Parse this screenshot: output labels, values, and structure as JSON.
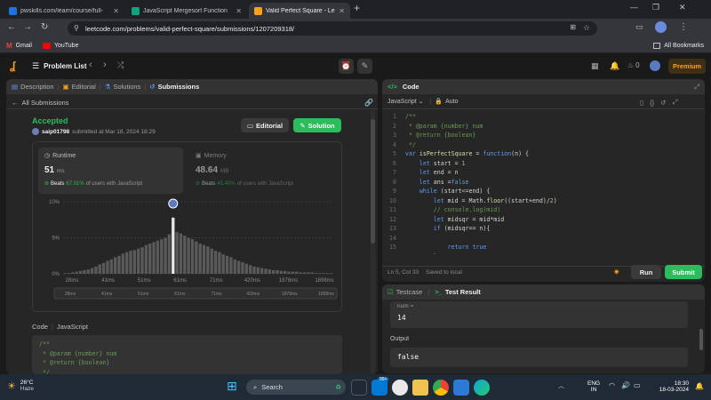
{
  "browser": {
    "tabs": [
      {
        "label": "pwskills.com/learn/course/full-",
        "color": "#1a73e8"
      },
      {
        "label": "JavaScript Mergesort Function",
        "color": "#10a37f"
      },
      {
        "label": "Valid Perfect Square - LeetCode",
        "color": "#ffa116"
      }
    ],
    "url": "leetcode.com/problems/valid-perfect-square/submissions/1207209318/",
    "bookmarks": [
      {
        "label": "Gmail"
      },
      {
        "label": "YouTube"
      }
    ],
    "all_bookmarks": "All Bookmarks"
  },
  "nav": {
    "problem_list": "Problem List",
    "streak_count": "0",
    "premium": "Premium"
  },
  "left": {
    "tabs": [
      "Description",
      "Editorial",
      "Solutions",
      "Submissions"
    ],
    "back": "All Submissions",
    "status": "Accepted",
    "user": "saip01798",
    "submitted": "submitted at Mar 18, 2024 18:29",
    "editorial_btn": "Editorial",
    "solution_btn": "Solution",
    "runtime": {
      "label": "Runtime",
      "value": "51",
      "unit": "ms",
      "beats_prefix": "Beats",
      "beats": "67.01%",
      "beats_suffix": "of users with JavaScript"
    },
    "memory": {
      "label": "Memory",
      "value": "48.64",
      "unit": "MB",
      "beats_prefix": "Beats",
      "beats": "45.40%",
      "beats_suffix": "of users with JavaScript"
    },
    "code_label": "Code",
    "code_lang": "JavaScript",
    "code_preview": [
      "/**",
      " * @param {number} num",
      " * @return {boolean}",
      " */"
    ]
  },
  "chart_data": {
    "type": "bar",
    "yticks": [
      "10%",
      "5%",
      "0%"
    ],
    "ylim": [
      0,
      10
    ],
    "xticks": [
      "28ms",
      "41ms",
      "51ms",
      "61ms",
      "71ms",
      "420ms",
      "1878ms",
      "1898ms"
    ],
    "range_ticks": [
      "28ms",
      "41ms",
      "51ms",
      "61ms",
      "71ms",
      "420ms",
      "1878ms",
      "1898ms"
    ],
    "highlight_index": 28,
    "values": [
      0.1,
      0.1,
      0.2,
      0.3,
      0.4,
      0.5,
      0.6,
      0.8,
      1.0,
      1.3,
      1.5,
      1.8,
      2.0,
      2.3,
      2.5,
      2.8,
      3.0,
      3.2,
      3.3,
      3.5,
      3.7,
      4.0,
      4.2,
      4.4,
      4.6,
      4.8,
      5.0,
      5.5,
      7.8,
      5.8,
      5.6,
      5.3,
      5.0,
      4.8,
      4.5,
      4.2,
      4.0,
      3.8,
      3.5,
      3.2,
      3.0,
      2.7,
      2.5,
      2.3,
      2.0,
      1.8,
      1.6,
      1.4,
      1.2,
      1.0,
      0.9,
      0.8,
      0.7,
      0.6,
      0.5,
      0.5,
      0.4,
      0.4,
      0.3,
      0.3,
      0.3,
      0.2,
      0.2,
      0.2,
      0.2,
      0.1,
      0.1,
      0.1,
      0.1,
      0.1
    ]
  },
  "code": {
    "title": "Code",
    "lang": "JavaScript",
    "auto": "Auto",
    "status_pos": "Ln 5, Col 33",
    "status_saved": "Saved to local",
    "run": "Run",
    "submit": "Submit"
  },
  "test": {
    "tab1": "Testcase",
    "tab2": "Test Result",
    "input_label": "num =",
    "input_value": "14",
    "output_label": "Output",
    "output_value": "false"
  },
  "taskbar": {
    "temp": "26°C",
    "weather": "Haze",
    "search": "Search",
    "lang1": "ENG",
    "lang2": "IN",
    "time": "18:30",
    "date": "18-03-2024",
    "badge": "99+"
  }
}
